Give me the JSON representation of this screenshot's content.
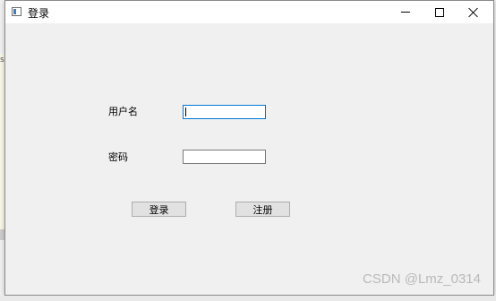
{
  "window": {
    "title": "登录",
    "icon": "window-app-icon"
  },
  "titlebar_controls": {
    "minimize": "minimize-icon",
    "maximize": "maximize-icon",
    "close": "close-icon"
  },
  "form": {
    "username_label": "用户名",
    "username_value": "",
    "password_label": "密码",
    "password_value": ""
  },
  "buttons": {
    "login": "登录",
    "register": "注册"
  },
  "watermark": "CSDN @Lmz_0314",
  "backdrop": {
    "edge_mark": "s"
  }
}
